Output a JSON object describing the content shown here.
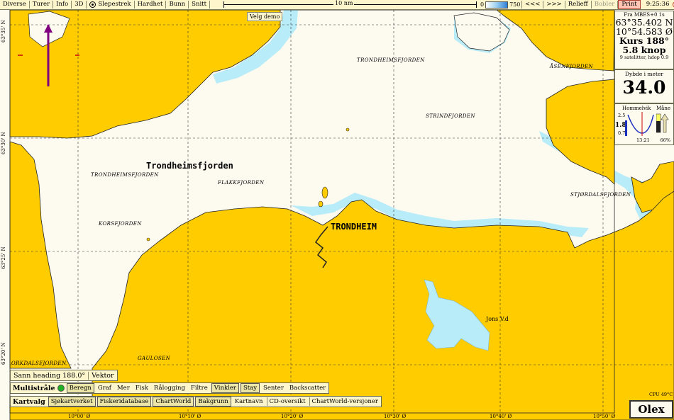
{
  "toolbar": {
    "items": [
      "Diverse",
      "Turer",
      "Info",
      "3D",
      "Slepestrek",
      "Hardhet",
      "Bunn",
      "Snitt"
    ],
    "scale_label": "10 nm",
    "depth_min": "0",
    "depth_max": "750",
    "nav_back": "<<<",
    "nav_forward": ">>>",
    "relieff": "Relieff",
    "bobler": "Bobler",
    "print": "Print",
    "time": "9:25:36"
  },
  "velg_demo": "Velg demo",
  "position": {
    "source": "Fra MBES+0 1s",
    "lat": "63°35.402 N",
    "lon": "10°54.583 Ø",
    "course": "Kurs 188°",
    "speed": "5.8 knop",
    "satellites": "9 satelitter, hdop 0.9"
  },
  "depth": {
    "caption": "Dybde i meter",
    "value": "34.0"
  },
  "tide": {
    "place": "Hommelvik",
    "moon_label": "Måne",
    "current_height": "1.8",
    "max": "2.5",
    "min": "0.7",
    "time": "13:21",
    "moon_percent": "66%"
  },
  "map_labels": {
    "trondheimsfjorden_big": "Trondheimsfjorden",
    "trondheimsfjorden_small": "TRONDHEIMSFJORDEN",
    "trondheimsfjorden_top": "TRONDHEIMSFJORDEN",
    "asenfjorden": "ÅSENFJORDEN",
    "strindfjorden": "STRINDFJORDEN",
    "flakkfjorden": "FLAKKFJORDEN",
    "korsfjorden": "KORSFJORDEN",
    "gaulosen": "GAULOSEN",
    "orkdalsfjorden": "ORKDALSFJORDEN",
    "stjordalsfjorden": "STJØRDALSFJORDEN",
    "trondheim": "TRONDHEIM",
    "jonsvatnet": "Jons V.d"
  },
  "heading": {
    "label": "Sann heading 188.0°",
    "vektor": "Vektor"
  },
  "multistrale": {
    "title": "Multistråle",
    "items": [
      "Beregn",
      "Graf",
      "Mer",
      "Fisk",
      "Rålogging",
      "Filtre",
      "Vinkler",
      "Stay",
      "Senter",
      "Backscatter"
    ],
    "active": [
      true,
      false,
      false,
      false,
      false,
      false,
      true,
      true,
      false,
      false
    ],
    "status_color": "#20b020"
  },
  "kartvalg": {
    "title": "Kartvalg",
    "items": [
      "Sjøkartverket",
      "Fiskeridatabase",
      "ChartWorld",
      "Bakgrunn",
      "Kartnavn",
      "CD-oversikt",
      "ChartWorld-versjoner"
    ],
    "active": [
      true,
      true,
      true,
      true,
      false,
      false,
      false
    ]
  },
  "cpu": "CPU 49°C",
  "brand": "Olex",
  "longitudes": [
    "10°00' Ø",
    "10°10' Ø",
    "10°20' Ø",
    "10°30' Ø",
    "10°40' Ø",
    "10°50' Ø"
  ],
  "latitudes": [
    "63°35' N",
    "63°30' N",
    "63°25' N",
    "63°20' N"
  ],
  "colors": {
    "land": "#ffcc00",
    "sea": "#fdfbf0",
    "shallow": "#b8ecf8",
    "coast": "#222222",
    "track": "#800080"
  }
}
